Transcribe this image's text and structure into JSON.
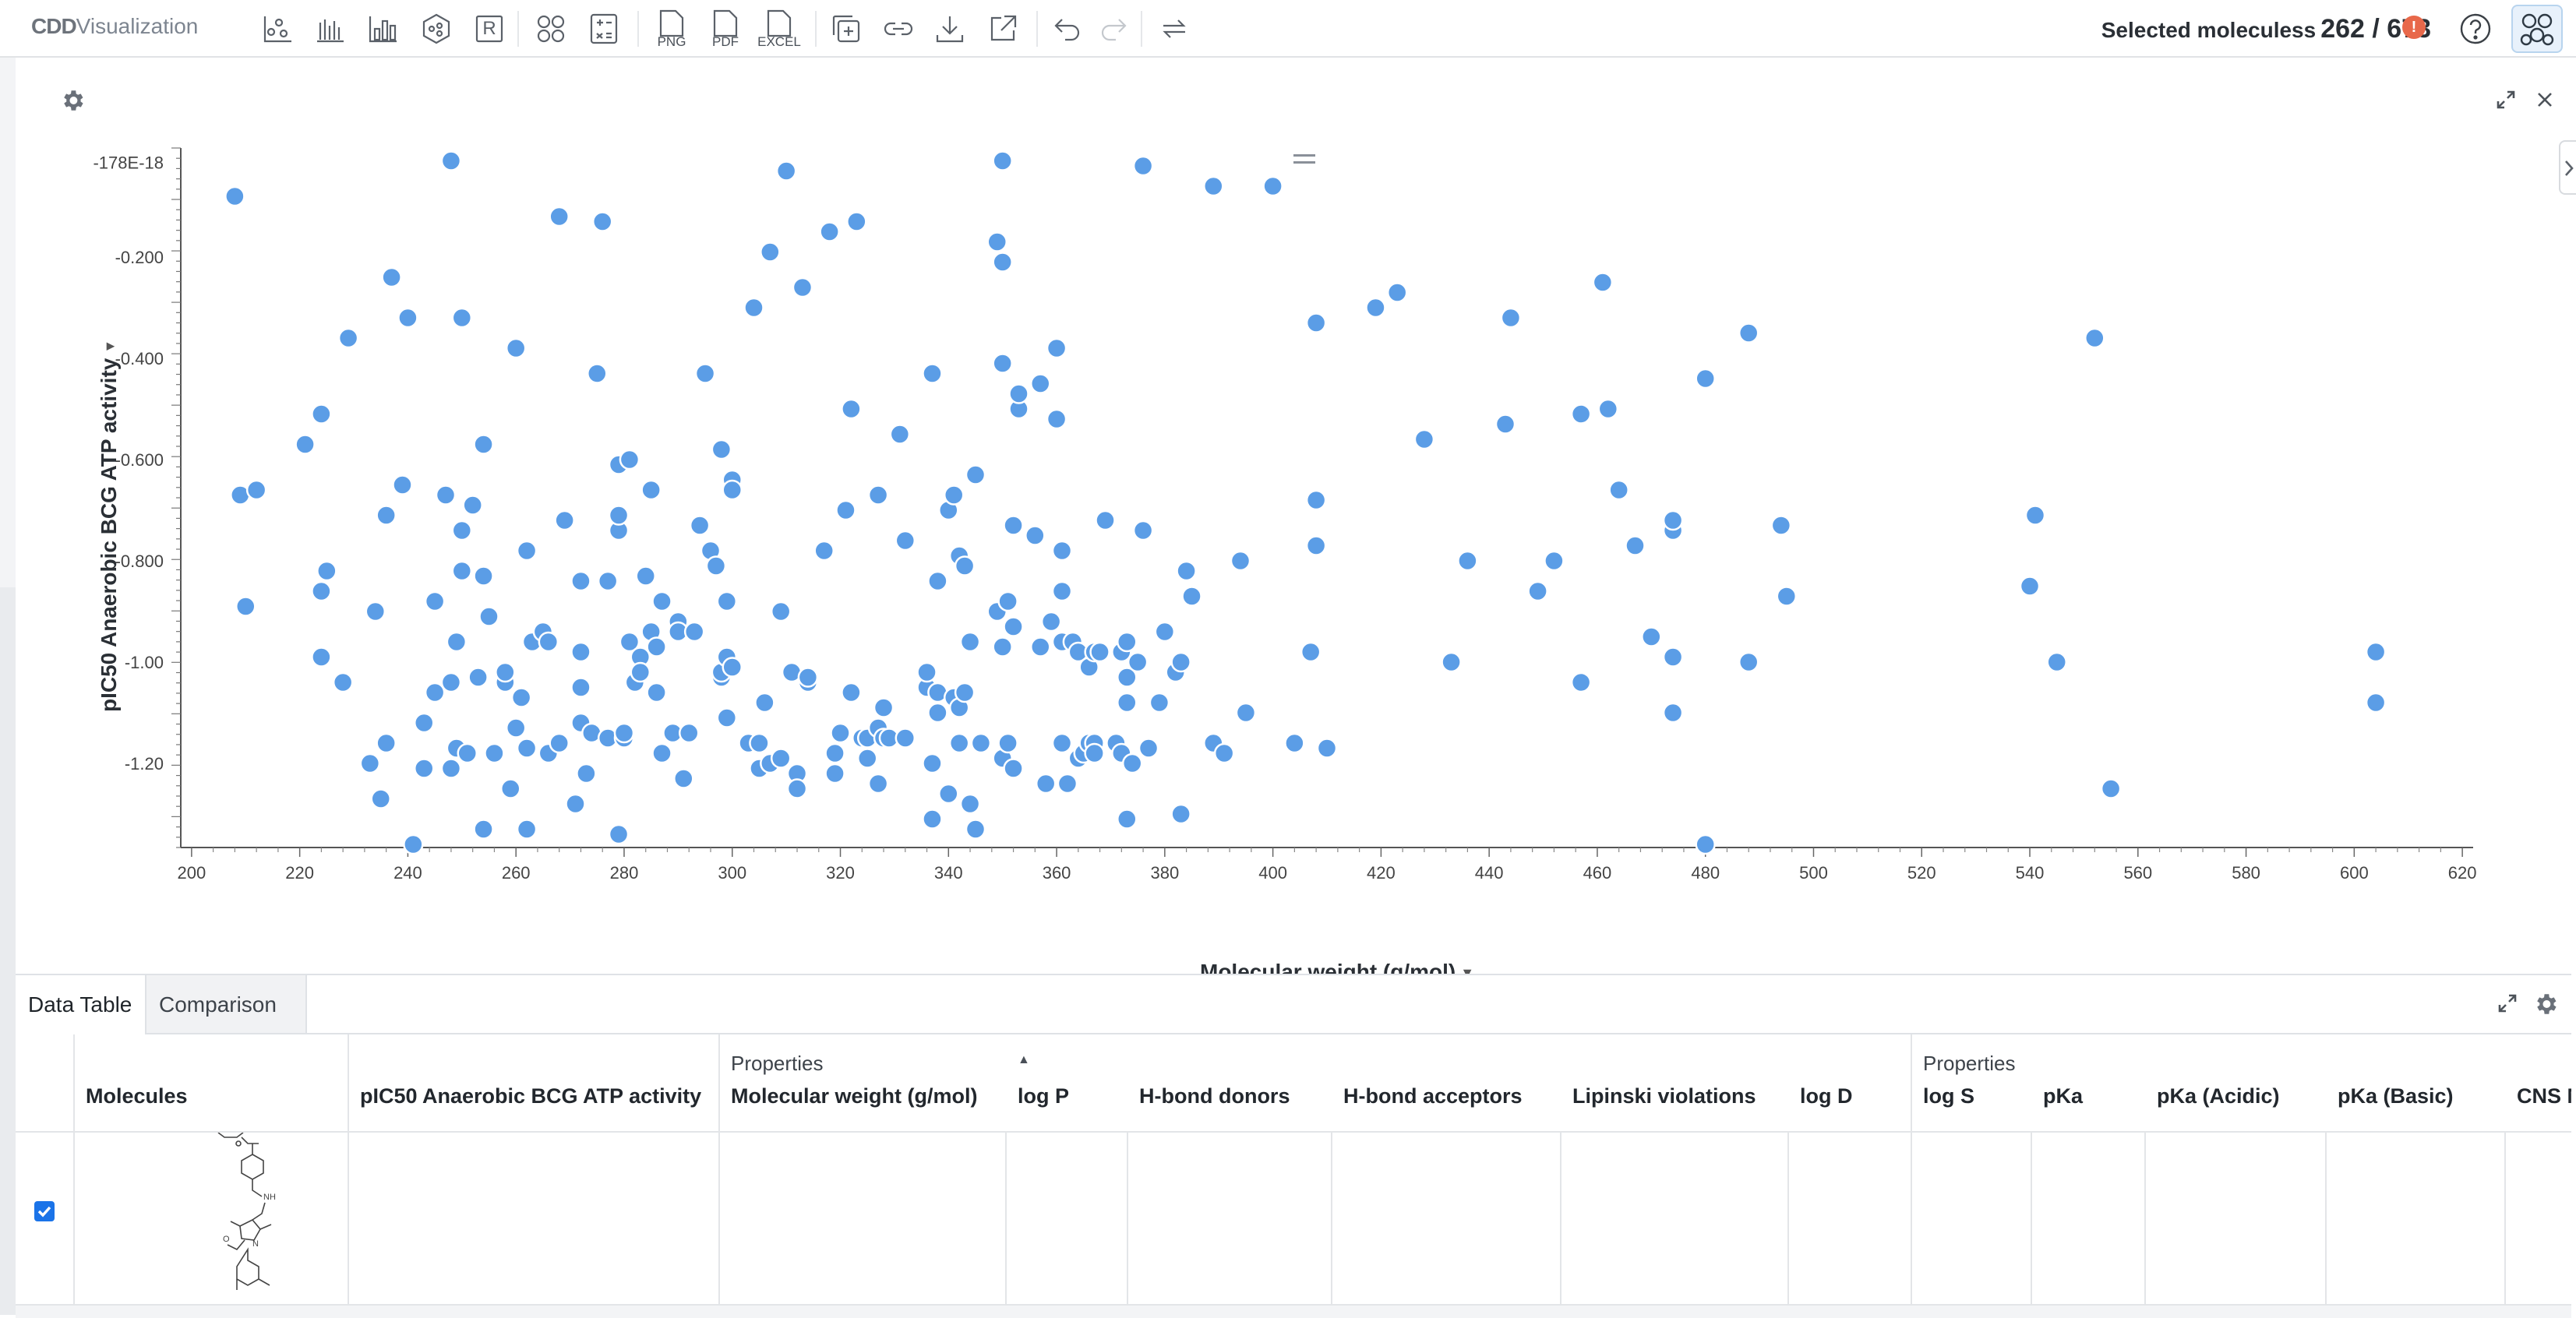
{
  "app": {
    "brand_cdd": "CDD",
    "brand_app": "Visualization",
    "selection_label": "Selected moleculess",
    "selection_count": "262 / 673",
    "warning_badge": "!",
    "export_png": "PNG",
    "export_pdf": "PDF",
    "export_excel": "EXCEL",
    "r_button": "R",
    "toolbar_icons": [
      "scatter-plot-icon",
      "histogram-icon",
      "bar-chart-icon",
      "hexagon-plot-icon",
      "r-script-icon",
      "molecule-grid-icon",
      "calculator-icon",
      "png-export-icon",
      "pdf-export-icon",
      "excel-export-icon",
      "add-panel-icon",
      "link-icon",
      "download-icon",
      "open-external-icon",
      "undo-icon",
      "redo-icon",
      "refresh-icon",
      "help-icon",
      "app-molecules-icon"
    ]
  },
  "chart_data": {
    "type": "scatter",
    "xlabel": "Molecular weight (g/mol)",
    "ylabel": "pIC50 Anaerobic BCG ATP activity",
    "xlim": [
      198,
      622
    ],
    "ylim": [
      -1.36,
      0.0
    ],
    "x_ticks": [
      "200",
      "220",
      "240",
      "260",
      "280",
      "300",
      "320",
      "340",
      "360",
      "380",
      "400",
      "420",
      "440",
      "460",
      "480",
      "500",
      "520",
      "540",
      "560",
      "580",
      "600",
      "620"
    ],
    "y_ticks": [
      {
        "value": -0.013,
        "label": "-178E-18"
      },
      {
        "value": -0.2,
        "label": "-0.200"
      },
      {
        "value": -0.4,
        "label": "-0.400"
      },
      {
        "value": -0.6,
        "label": "-0.600"
      },
      {
        "value": -0.8,
        "label": "-0.800"
      },
      {
        "value": -1.0,
        "label": "-1.00"
      },
      {
        "value": -1.2,
        "label": "-1.20"
      }
    ],
    "point_color": "#5b9de6",
    "points": [
      [
        208,
        -0.08
      ],
      [
        209,
        -0.67
      ],
      [
        210,
        -0.89
      ],
      [
        212,
        -0.66
      ],
      [
        221,
        -0.57
      ],
      [
        224,
        -0.86
      ],
      [
        224,
        -0.51
      ],
      [
        224,
        -0.99
      ],
      [
        225,
        -0.82
      ],
      [
        228,
        -1.04
      ],
      [
        229,
        -0.36
      ],
      [
        233,
        -1.2
      ],
      [
        234,
        -0.9
      ],
      [
        235,
        -1.27
      ],
      [
        236,
        -1.16
      ],
      [
        236,
        -0.71
      ],
      [
        237,
        -0.24
      ],
      [
        239,
        -0.65
      ],
      [
        240,
        -0.32
      ],
      [
        241,
        -1.36
      ],
      [
        243,
        -1.12
      ],
      [
        243,
        -1.21
      ],
      [
        245,
        -0.88
      ],
      [
        245,
        -1.06
      ],
      [
        247,
        -0.67
      ],
      [
        248,
        -1.04
      ],
      [
        248,
        -1.21
      ],
      [
        248,
        -0.01
      ],
      [
        249,
        -0.96
      ],
      [
        249,
        -1.17
      ],
      [
        250,
        -0.32
      ],
      [
        250,
        -0.74
      ],
      [
        250,
        -0.82
      ],
      [
        251,
        -1.18
      ],
      [
        252,
        -0.69
      ],
      [
        253,
        -1.03
      ],
      [
        254,
        -0.57
      ],
      [
        254,
        -0.83
      ],
      [
        254,
        -1.33
      ],
      [
        255,
        -0.91
      ],
      [
        256,
        -1.18
      ],
      [
        258,
        -1.04
      ],
      [
        258,
        -1.02
      ],
      [
        259,
        -1.25
      ],
      [
        260,
        -1.13
      ],
      [
        260,
        -0.38
      ],
      [
        261,
        -1.07
      ],
      [
        262,
        -1.17
      ],
      [
        262,
        -0.78
      ],
      [
        262,
        -1.33
      ],
      [
        263,
        -0.96
      ],
      [
        265,
        -0.94
      ],
      [
        266,
        -0.96
      ],
      [
        266,
        -1.18
      ],
      [
        268,
        -1.16
      ],
      [
        268,
        -0.12
      ],
      [
        269,
        -0.72
      ],
      [
        271,
        -1.28
      ],
      [
        272,
        -0.84
      ],
      [
        272,
        -0.98
      ],
      [
        272,
        -1.05
      ],
      [
        272,
        -1.12
      ],
      [
        273,
        -1.22
      ],
      [
        274,
        -1.14
      ],
      [
        275,
        -0.43
      ],
      [
        276,
        -0.13
      ],
      [
        277,
        -1.15
      ],
      [
        277,
        -0.84
      ],
      [
        279,
        -0.74
      ],
      [
        279,
        -0.71
      ],
      [
        279,
        -0.61
      ],
      [
        279,
        -1.34
      ],
      [
        280,
        -1.15
      ],
      [
        280,
        -1.14
      ],
      [
        281,
        -0.96
      ],
      [
        281,
        -0.6
      ],
      [
        282,
        -1.04
      ],
      [
        283,
        -0.99
      ],
      [
        283,
        -1.02
      ],
      [
        284,
        -0.83
      ],
      [
        285,
        -0.94
      ],
      [
        285,
        -0.66
      ],
      [
        286,
        -1.06
      ],
      [
        286,
        -0.97
      ],
      [
        287,
        -0.88
      ],
      [
        287,
        -1.18
      ],
      [
        289,
        -1.14
      ],
      [
        290,
        -0.92
      ],
      [
        290,
        -0.94
      ],
      [
        291,
        -1.23
      ],
      [
        292,
        -1.14
      ],
      [
        293,
        -0.94
      ],
      [
        294,
        -0.73
      ],
      [
        295,
        -0.43
      ],
      [
        296,
        -0.78
      ],
      [
        297,
        -0.81
      ],
      [
        298,
        -1.03
      ],
      [
        298,
        -0.58
      ],
      [
        298,
        -1.02
      ],
      [
        299,
        -1.11
      ],
      [
        299,
        -0.88
      ],
      [
        299,
        -0.99
      ],
      [
        300,
        -1.01
      ],
      [
        300,
        -0.64
      ],
      [
        300,
        -0.66
      ],
      [
        303,
        -1.16
      ],
      [
        304,
        -0.3
      ],
      [
        305,
        -1.21
      ],
      [
        305,
        -1.16
      ],
      [
        306,
        -1.08
      ],
      [
        307,
        -0.19
      ],
      [
        307,
        -1.2
      ],
      [
        309,
        -0.9
      ],
      [
        309,
        -1.19
      ],
      [
        310,
        -0.03
      ],
      [
        311,
        -1.02
      ],
      [
        312,
        -1.22
      ],
      [
        312,
        -1.25
      ],
      [
        313,
        -0.26
      ],
      [
        314,
        -1.04
      ],
      [
        314,
        -1.03
      ],
      [
        317,
        -0.78
      ],
      [
        318,
        -0.15
      ],
      [
        319,
        -1.18
      ],
      [
        319,
        -1.22
      ],
      [
        320,
        -1.14
      ],
      [
        321,
        -0.7
      ],
      [
        322,
        -0.5
      ],
      [
        322,
        -1.06
      ],
      [
        323,
        -0.13
      ],
      [
        324,
        -1.15
      ],
      [
        325,
        -1.19
      ],
      [
        325,
        -1.15
      ],
      [
        327,
        -1.13
      ],
      [
        327,
        -0.67
      ],
      [
        327,
        -1.24
      ],
      [
        328,
        -1.09
      ],
      [
        328,
        -1.15
      ],
      [
        329,
        -1.15
      ],
      [
        331,
        -0.55
      ],
      [
        332,
        -1.15
      ],
      [
        332,
        -0.76
      ],
      [
        336,
        -1.05
      ],
      [
        336,
        -1.02
      ],
      [
        337,
        -0.43
      ],
      [
        337,
        -1.2
      ],
      [
        337,
        -1.31
      ],
      [
        338,
        -0.84
      ],
      [
        338,
        -1.06
      ],
      [
        338,
        -1.1
      ],
      [
        340,
        -1.26
      ],
      [
        340,
        -0.7
      ],
      [
        341,
        -0.67
      ],
      [
        341,
        -1.07
      ],
      [
        342,
        -1.09
      ],
      [
        342,
        -1.16
      ],
      [
        342,
        -0.79
      ],
      [
        343,
        -0.81
      ],
      [
        343,
        -1.06
      ],
      [
        344,
        -0.96
      ],
      [
        344,
        -1.28
      ],
      [
        345,
        -0.63
      ],
      [
        345,
        -1.33
      ],
      [
        346,
        -1.16
      ],
      [
        349,
        -0.9
      ],
      [
        349,
        -0.17
      ],
      [
        350,
        -1.19
      ],
      [
        350,
        -0.97
      ],
      [
        350,
        -0.21
      ],
      [
        350,
        -0.41
      ],
      [
        350,
        -0.01
      ],
      [
        351,
        -0.88
      ],
      [
        351,
        -1.16
      ],
      [
        352,
        -0.73
      ],
      [
        352,
        -1.21
      ],
      [
        352,
        -0.93
      ],
      [
        353,
        -0.5
      ],
      [
        353,
        -0.47
      ],
      [
        356,
        -0.75
      ],
      [
        357,
        -0.45
      ],
      [
        357,
        -0.97
      ],
      [
        358,
        -1.24
      ],
      [
        359,
        -0.92
      ],
      [
        360,
        -0.38
      ],
      [
        360,
        -0.52
      ],
      [
        361,
        -0.96
      ],
      [
        361,
        -1.16
      ],
      [
        361,
        -0.86
      ],
      [
        361,
        -0.78
      ],
      [
        362,
        -1.24
      ],
      [
        363,
        -0.96
      ],
      [
        364,
        -0.98
      ],
      [
        364,
        -1.19
      ],
      [
        365,
        -1.18
      ],
      [
        366,
        -1.01
      ],
      [
        366,
        -1.16
      ],
      [
        367,
        -1.16
      ],
      [
        367,
        -0.98
      ],
      [
        367,
        -1.18
      ],
      [
        368,
        -0.98
      ],
      [
        369,
        -0.72
      ],
      [
        371,
        -1.16
      ],
      [
        372,
        -0.98
      ],
      [
        372,
        -1.18
      ],
      [
        373,
        -1.31
      ],
      [
        373,
        -0.96
      ],
      [
        373,
        -1.08
      ],
      [
        373,
        -1.03
      ],
      [
        374,
        -1.2
      ],
      [
        375,
        -1.0
      ],
      [
        376,
        -0.74
      ],
      [
        376,
        -0.02
      ],
      [
        377,
        -1.17
      ],
      [
        379,
        -1.08
      ],
      [
        380,
        -0.94
      ],
      [
        382,
        -1.02
      ],
      [
        383,
        -1.0
      ],
      [
        383,
        -1.3
      ],
      [
        384,
        -0.82
      ],
      [
        385,
        -0.87
      ],
      [
        389,
        -1.16
      ],
      [
        389,
        -0.06
      ],
      [
        391,
        -1.18
      ],
      [
        394,
        -0.8
      ],
      [
        395,
        -1.1
      ],
      [
        400,
        -0.06
      ],
      [
        404,
        -1.16
      ],
      [
        407,
        -0.98
      ],
      [
        408,
        -0.68
      ],
      [
        408,
        -0.77
      ],
      [
        408,
        -0.33
      ],
      [
        410,
        -1.17
      ],
      [
        419,
        -0.3
      ],
      [
        423,
        -0.27
      ],
      [
        428,
        -0.56
      ],
      [
        433,
        -1.0
      ],
      [
        436,
        -0.8
      ],
      [
        443,
        -0.53
      ],
      [
        444,
        -0.32
      ],
      [
        449,
        -0.86
      ],
      [
        452,
        -0.8
      ],
      [
        457,
        -0.51
      ],
      [
        457,
        -1.04
      ],
      [
        461,
        -0.25
      ],
      [
        462,
        -0.5
      ],
      [
        464,
        -0.66
      ],
      [
        467,
        -0.77
      ],
      [
        470,
        -0.95
      ],
      [
        474,
        -0.74
      ],
      [
        474,
        -0.72
      ],
      [
        474,
        -0.99
      ],
      [
        474,
        -1.1
      ],
      [
        480,
        -1.36
      ],
      [
        480,
        -0.44
      ],
      [
        488,
        -1.0
      ],
      [
        488,
        -0.35
      ],
      [
        494,
        -0.73
      ],
      [
        495,
        -0.87
      ],
      [
        540,
        -0.85
      ],
      [
        541,
        -0.71
      ],
      [
        545,
        -1.0
      ],
      [
        552,
        -0.36
      ],
      [
        555,
        -1.25
      ],
      [
        604,
        -0.98
      ],
      [
        604,
        -1.08
      ]
    ]
  },
  "table": {
    "tab_data": "Data Table",
    "tab_comparison": "Comparison",
    "group_properties_1": "Properties",
    "group_properties_2": "Properties",
    "columns": [
      "Molecules",
      "pIC50 Anaerobic BCG ATP activity",
      "Molecular weight (g/mol)",
      "log P",
      "H-bond donors",
      "H-bond acceptors",
      "Lipinski violations",
      "log D",
      "log S",
      "pKa",
      "pKa (Acidic)",
      "pKa (Basic)",
      "CNS M"
    ],
    "sort_indicator": "▲",
    "row_checked": true
  }
}
